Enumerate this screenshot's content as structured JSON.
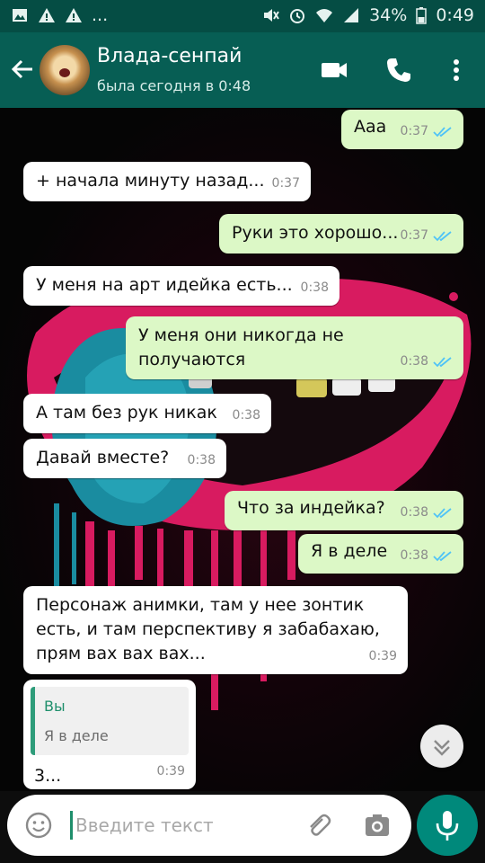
{
  "status_bar": {
    "battery": "34%",
    "time": "0:49",
    "more": "..."
  },
  "header": {
    "name": "Влада-сенпай",
    "status": "была сегодня в 0:48"
  },
  "messages": [
    {
      "dir": "out",
      "text": "Ааа",
      "time": "0:37"
    },
    {
      "dir": "in",
      "text": "+ начала минуту назад...",
      "time": "0:37"
    },
    {
      "dir": "out",
      "text": "Руки это хорошо...",
      "time": "0:37"
    },
    {
      "dir": "in",
      "text": "У меня на арт идейка есть...",
      "time": "0:38"
    },
    {
      "dir": "out",
      "text": "У меня они никогда не получаются",
      "time": "0:38"
    },
    {
      "dir": "in",
      "text": "А там без рук никак",
      "time": "0:38"
    },
    {
      "dir": "in",
      "text": "Давай вместе?",
      "time": "0:38"
    },
    {
      "dir": "out",
      "text": "Что за индейка?",
      "time": "0:38"
    },
    {
      "dir": "out",
      "text": "Я в деле",
      "time": "0:38"
    },
    {
      "dir": "in",
      "text": "Персонаж анимки, там у нее зонтик есть, и там перспективу я забабахаю, прям вах вах вах...",
      "time": "0:39"
    },
    {
      "dir": "in",
      "text": "3...",
      "time": "0:39",
      "quote": {
        "author": "Вы",
        "text": "Я в деле"
      }
    }
  ],
  "input": {
    "placeholder": "Введите текст"
  },
  "colors": {
    "header": "#075e54",
    "statusbar": "#054d44",
    "outgoing": "#dcf8c6",
    "incoming": "#ffffff",
    "accent": "#00897b",
    "read_ticks": "#4fc3f7"
  },
  "icons": [
    "back-arrow-icon",
    "video-call-icon",
    "phone-icon",
    "more-vert-icon",
    "double-check-icon",
    "scroll-down-icon",
    "emoji-icon",
    "attach-icon",
    "camera-icon",
    "mic-icon"
  ]
}
